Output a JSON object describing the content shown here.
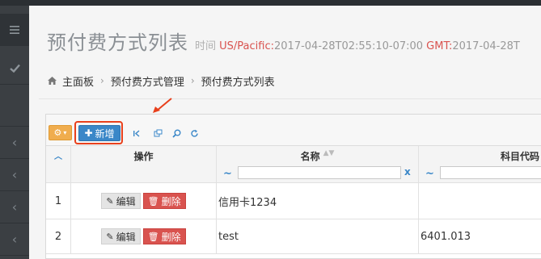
{
  "header": {
    "title": "预付费方式列表",
    "time_label": "时间",
    "timezone": "US/Pacific:",
    "local_time": "2017-04-28T02:55:10-07:00",
    "gmt_label": "GMT:",
    "gmt_time": "2017-04-28T"
  },
  "breadcrumb": {
    "items": [
      "主面板",
      "预付费方式管理",
      "预付费方式列表"
    ]
  },
  "toolbar": {
    "add_label": "新增"
  },
  "table": {
    "columns": [
      "操作",
      "名称",
      "科目代码"
    ],
    "filter_symbol": "~",
    "clear_symbol": "x",
    "edit_label": "编辑",
    "delete_label": "删除",
    "rows": [
      {
        "index": "1",
        "name": "信用卡1234",
        "code": ""
      },
      {
        "index": "2",
        "name": "test",
        "code": "6401.013"
      }
    ]
  },
  "colors": {
    "sidebar": "#3b3f43",
    "primary": "#3a87c8",
    "warning": "#f0ad4e",
    "danger": "#d9534f",
    "annotation": "#e8401c"
  }
}
